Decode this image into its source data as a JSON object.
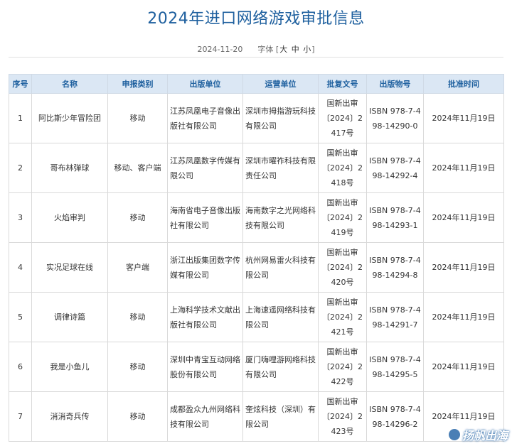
{
  "title": "2024年进口网络游戏审批信息",
  "meta": {
    "date": "2024-11-20",
    "font_label": "字体",
    "bracket_open": "[",
    "bracket_close": "]",
    "size_large": "大",
    "size_medium": "中",
    "size_small": "小"
  },
  "table": {
    "headers": [
      "序号",
      "名称",
      "申报类别",
      "出版单位",
      "运营单位",
      "批复文号",
      "出版物号",
      "批准时间"
    ],
    "rows": [
      [
        "1",
        "阿比斯少年冒险团",
        "移动",
        "江苏凤凰电子音像出版社有限公司",
        "深圳市拇指游玩科技有限公司",
        "国新出审〔2024〕2417号",
        "ISBN 978-7-498-14290-0",
        "2024年11月19日"
      ],
      [
        "2",
        "哥布林弹球",
        "移动、客户端",
        "江苏凤凰数字传媒有限公司",
        "深圳市曜祚科技有限责任公司",
        "国新出审〔2024〕2418号",
        "ISBN 978-7-498-14292-4",
        "2024年11月19日"
      ],
      [
        "3",
        "火焰审判",
        "移动",
        "海南省电子音像出版社有限公司",
        "海南数字之光网络科技有限公司",
        "国新出审〔2024〕2419号",
        "ISBN 978-7-498-14293-1",
        "2024年11月19日"
      ],
      [
        "4",
        "实况足球在线",
        "客户端",
        "浙江出版集团数字传媒有限公司",
        "杭州网易雷火科技有限公司",
        "国新出审〔2024〕2420号",
        "ISBN 978-7-498-14294-8",
        "2024年11月19日"
      ],
      [
        "5",
        "调律诗篇",
        "移动",
        "上海科学技术文献出版社有限公司",
        "上海速遥网络科技有限公司",
        "国新出审〔2024〕2421号",
        "ISBN 978-7-498-14291-7",
        "2024年11月19日"
      ],
      [
        "6",
        "我是小鱼儿",
        "移动",
        "深圳中青宝互动网络股份有限公司",
        "厦门嗨哩游网络科技有限公司",
        "国新出审〔2024〕2422号",
        "ISBN 978-7-498-14295-5",
        "2024年11月19日"
      ],
      [
        "7",
        "消消奇兵传",
        "移动",
        "成都盈众九州网络科技有限公司",
        "奎炫科技（深圳）有限公司",
        "国新出审〔2024〕2423号",
        "ISBN 978-7-498-14296-2",
        "2024年11月19日"
      ]
    ]
  },
  "watermark": {
    "text": "扬帆出海"
  },
  "colors": {
    "accent": "#1d5f9e",
    "header_bg": "#dbe7f4",
    "border": "#d9d9d9"
  }
}
